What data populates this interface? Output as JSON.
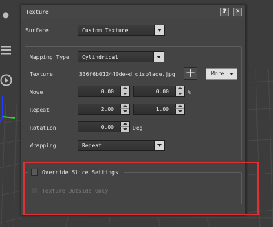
{
  "dialog": {
    "title": "Texture",
    "help_label": "?",
    "close_label": "✕"
  },
  "surface": {
    "label": "Surface",
    "value": "Custom Texture"
  },
  "mapping": {
    "label": "Mapping Type",
    "value": "Cylindrical"
  },
  "texture": {
    "label": "Texture",
    "filename": "336f6b012440de⋯d_displace.jpg",
    "add_label": "+",
    "more_label": "More"
  },
  "move": {
    "label": "Move",
    "x": "0.00",
    "y": "0.00",
    "unit": "%"
  },
  "repeat": {
    "label": "Repeat",
    "x": "2.00",
    "y": "1.00"
  },
  "rotation": {
    "label": "Rotation",
    "value": "0.00",
    "unit": "Deg"
  },
  "wrapping": {
    "label": "Wrapping",
    "value": "Repeat"
  },
  "override": {
    "label": "Override Slice Settings",
    "checked": false
  },
  "outside_only": {
    "label": "Texture Outside Only",
    "checked": false,
    "enabled": false
  },
  "colors": {
    "highlight": "#e03030",
    "dialog_bg": "#444444",
    "axis_blue": "#1f3cff",
    "axis_green": "#2fd02f"
  }
}
